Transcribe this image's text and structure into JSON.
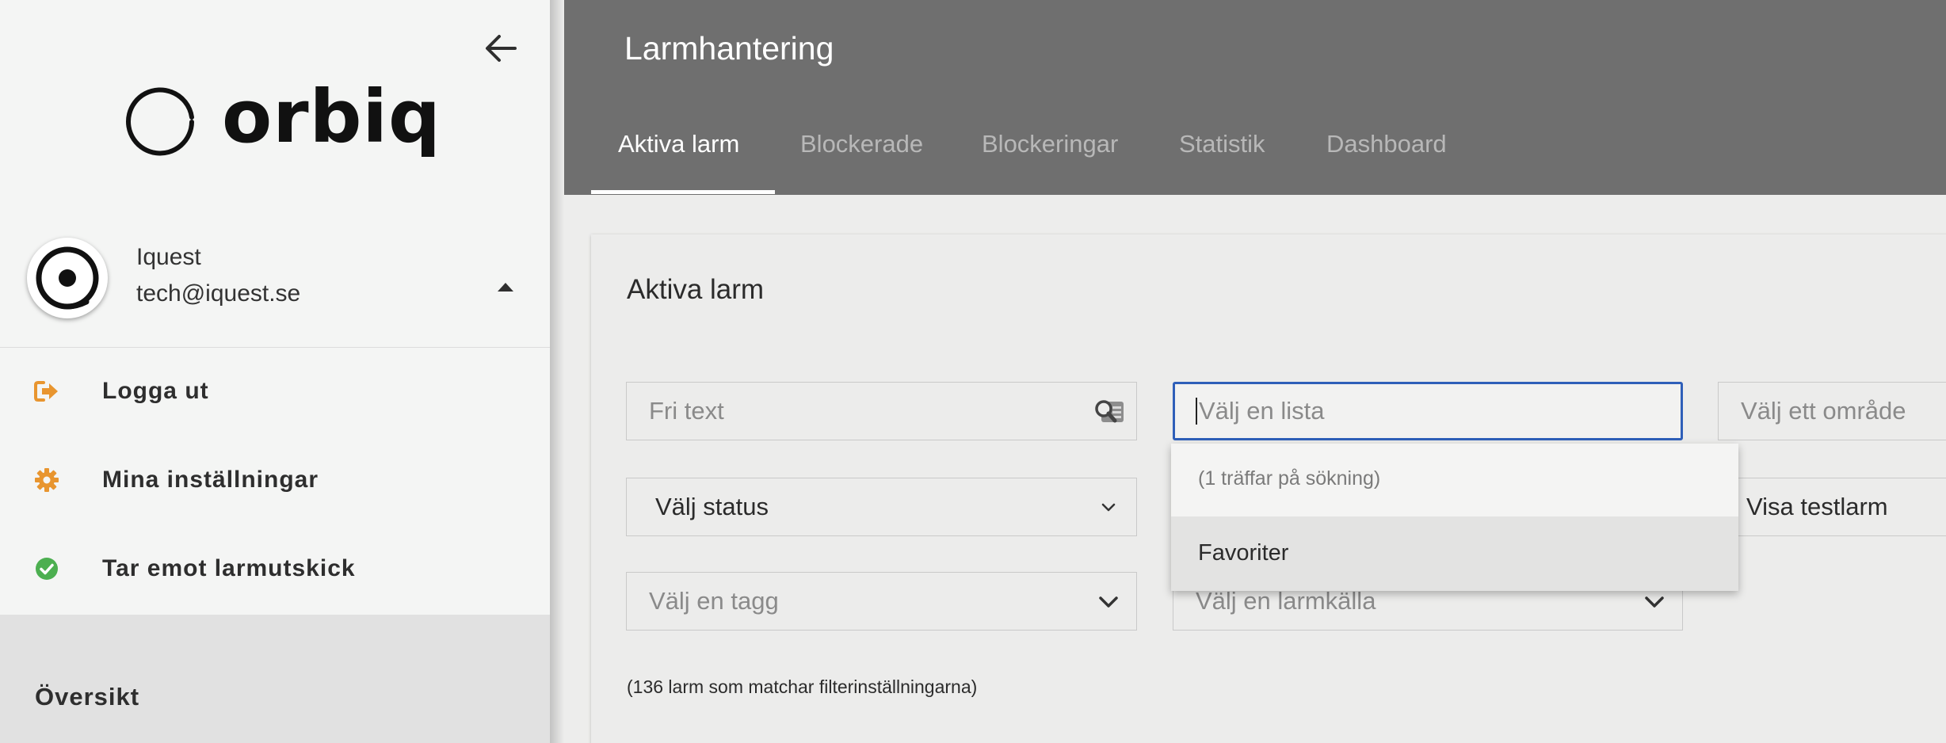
{
  "app": {
    "brand": "orbiq",
    "page_title": "Larmhantering"
  },
  "user": {
    "name": "Iquest",
    "email": "tech@iquest.se"
  },
  "menu": [
    {
      "label": "Logga ut",
      "icon": "sign-out-icon",
      "color": "#e8952f"
    },
    {
      "label": "Mina inställningar",
      "icon": "gear-icon",
      "color": "#e8952f"
    },
    {
      "label": "Tar emot larmutskick",
      "icon": "check-circle-icon",
      "color": "#4caf50"
    }
  ],
  "section": {
    "label": "Översikt"
  },
  "tabs": [
    {
      "label": "Aktiva larm",
      "active": true
    },
    {
      "label": "Blockerade",
      "active": false
    },
    {
      "label": "Blockeringar",
      "active": false
    },
    {
      "label": "Statistik",
      "active": false
    },
    {
      "label": "Dashboard",
      "active": false
    }
  ],
  "card": {
    "title": "Aktiva larm",
    "count_text": "(136 larm som matchar filterinställningarna)"
  },
  "filters": {
    "free_text_placeholder": "Fri text",
    "list_placeholder": "Välj en lista",
    "area_placeholder": "Välj ett område",
    "status_value": "Välj status",
    "test_alarm_label": "Visa testlarm",
    "tag_placeholder": "Välj en tagg",
    "source_placeholder": "Välj en larmkälla"
  },
  "dropdown": {
    "hint": "(1 träffar på sökning)",
    "options": [
      "Favoriter"
    ]
  },
  "colors": {
    "header_bg": "#6f6f6f",
    "focus_border": "#2f5fb9",
    "accent_orange": "#e8952f",
    "accent_green": "#4caf50"
  }
}
